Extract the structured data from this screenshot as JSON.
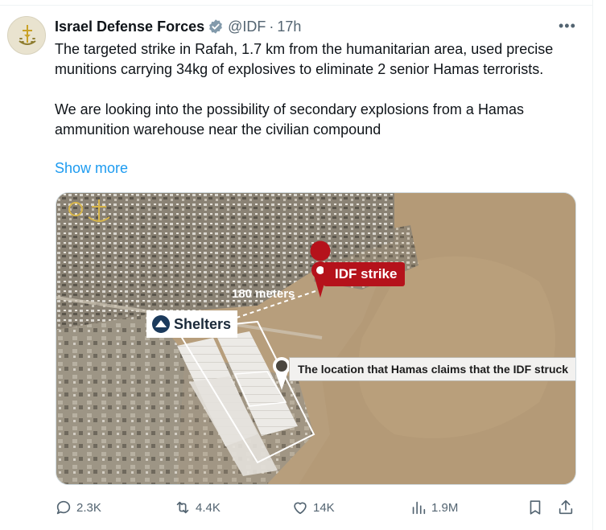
{
  "author": {
    "name": "Israel Defense Forces",
    "handle": "@IDF",
    "separator": "·",
    "time": "17h",
    "verified": true,
    "avatar_icon": "idf-emblem-icon"
  },
  "tweet": {
    "paragraph1": "The targeted strike in Rafah, 1.7 km from the humanitarian area, used precise munitions carrying 34kg of explosives to eliminate 2 senior Hamas terrorists.",
    "paragraph2": "We are looking into the possibility of secondary explosions from a Hamas ammunition warehouse near the civilian compound",
    "show_more": "Show more"
  },
  "media": {
    "labels": {
      "strike": "IDF strike",
      "distance": "180 meters",
      "shelters": "Shelters",
      "claim": "The location that Hamas claims that the IDF struck"
    }
  },
  "actions": {
    "replies": "2.3K",
    "reposts": "4.4K",
    "likes": "14K",
    "views": "1.9M"
  },
  "colors": {
    "accent": "#1d9bf0",
    "verified": "#829aab",
    "text": "#0f1419",
    "secondary": "#536471",
    "strike_label": "#b5121b"
  }
}
